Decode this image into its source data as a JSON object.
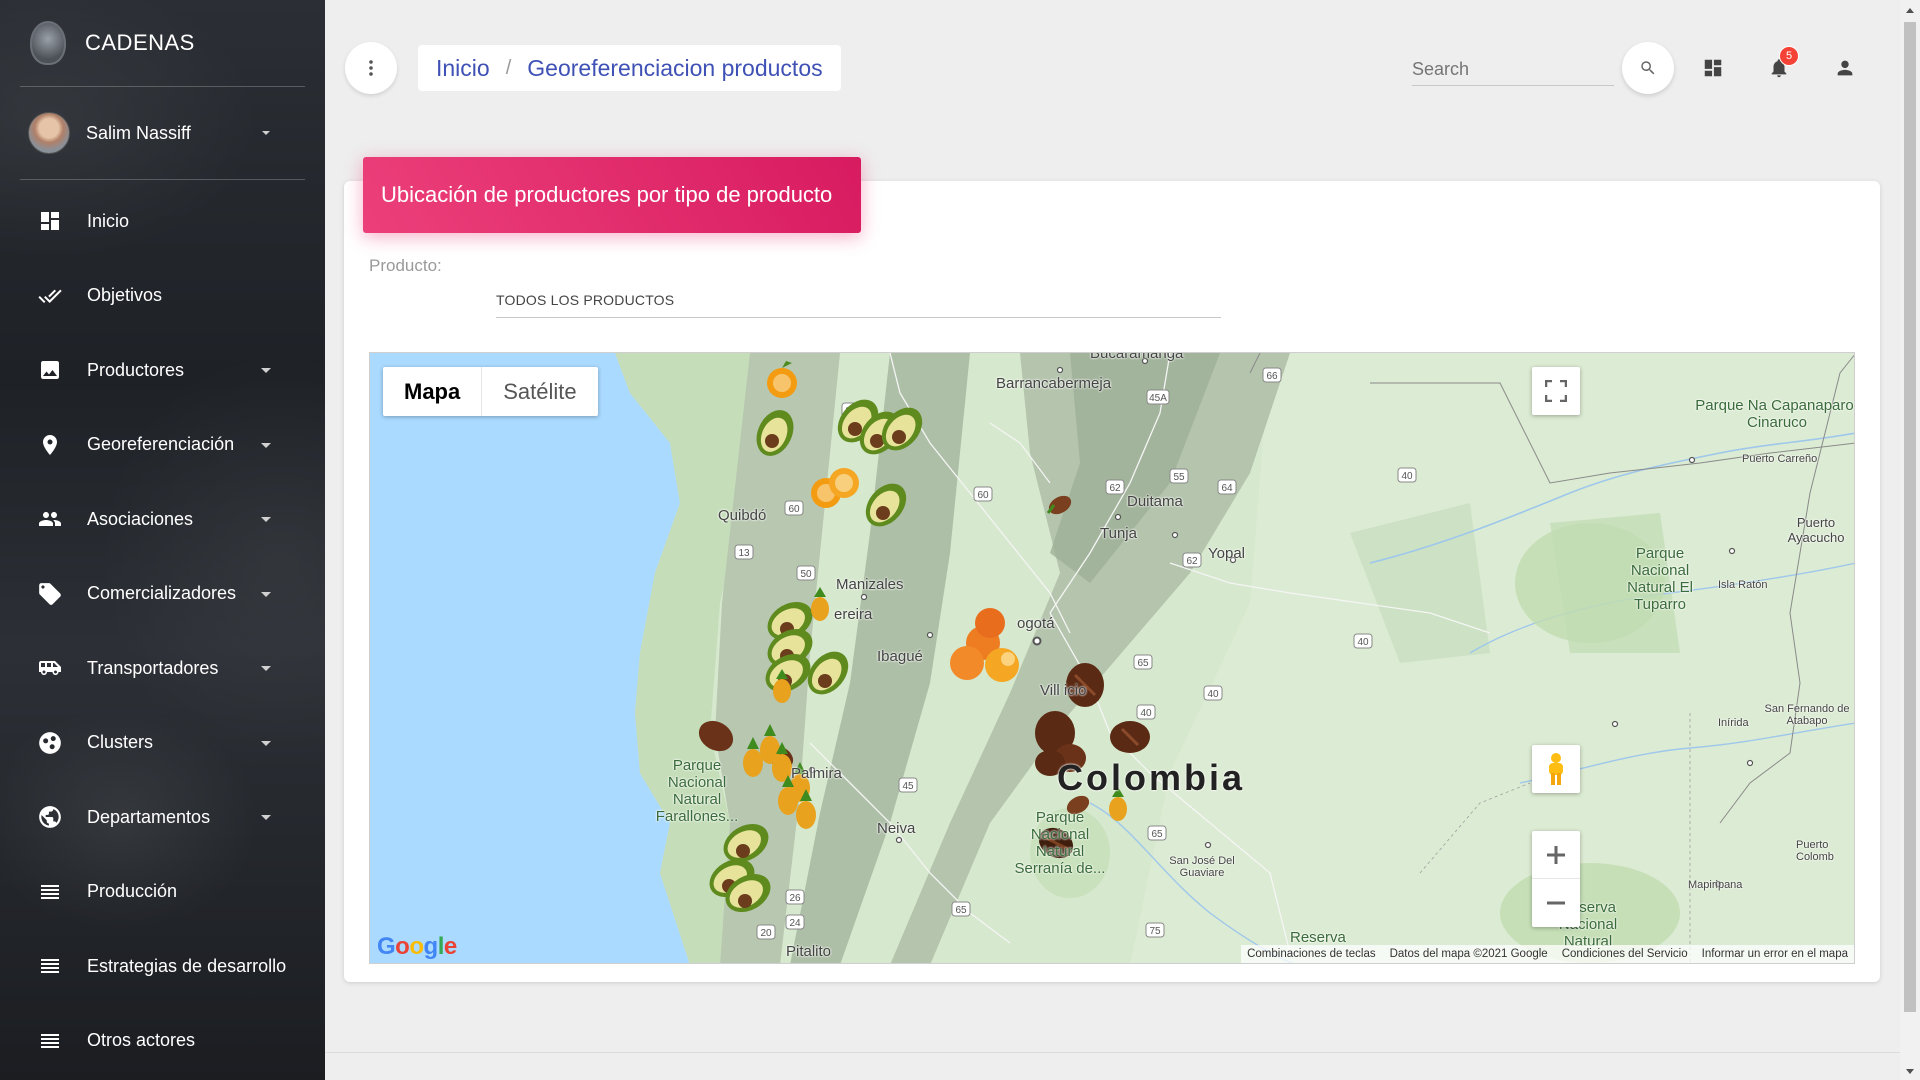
{
  "brand": {
    "name": "CADENAS"
  },
  "user": {
    "name": "Salim Nassiff"
  },
  "nav": {
    "items": [
      {
        "label": "Inicio",
        "icon": "dashboard-icon"
      },
      {
        "label": "Objetivos",
        "icon": "double-check-icon"
      },
      {
        "label": "Productores",
        "icon": "image-icon"
      },
      {
        "label": "Georeferenciación",
        "icon": "location-pin-icon"
      },
      {
        "label": "Asociaciones",
        "icon": "people-icon"
      },
      {
        "label": "Comercializadores",
        "icon": "tag-icon"
      },
      {
        "label": "Transportadores",
        "icon": "bus-icon"
      },
      {
        "label": "Clusters",
        "icon": "bubbles-icon"
      },
      {
        "label": "Departamentos",
        "icon": "globe-icon"
      },
      {
        "label": "Producción",
        "icon": "list-icon"
      },
      {
        "label": "Estrategias de desarrollo",
        "icon": "list-icon"
      },
      {
        "label": "Otros actores",
        "icon": "list-icon"
      }
    ]
  },
  "breadcrumb": {
    "home": "Inicio",
    "separator": "/",
    "current": "Georeferenciacion productos"
  },
  "search": {
    "placeholder": "Search"
  },
  "notifications": {
    "count": "5"
  },
  "card": {
    "title": "Ubicación de productores por tipo de producto",
    "product_label": "Producto:",
    "product_value": "TODOS LOS PRODUCTOS"
  },
  "map": {
    "type_options": {
      "map": "Mapa",
      "satellite": "Satélite"
    },
    "labels": {
      "bucaramanga": "Bucaramanga",
      "barrancabermeja": "Barrancabermeja",
      "quibdo": "Quibdó",
      "manizales": "Manizales",
      "pereira": "ereira",
      "ibague": "Ibagué",
      "bogota": "ogotá",
      "tunja": "Tunja",
      "duitama": "Duitama",
      "yopal": "Yopal",
      "villavicencio": "Vill   icio",
      "colombia": "Colombia",
      "palmira": "Palmira",
      "neiva": "Neiva",
      "pitalito": "Pitalito",
      "sanjose": "San José Del Guaviare",
      "mapiripana": "Mapiripana",
      "inirida": "Inírida",
      "islaraton": "Isla Ratón",
      "puertocarreno": "Puerto Carreño",
      "puertoayacucho": "Puerto Ayacucho",
      "sanfernando": "San Fernando de Atabapo",
      "farallones": "Parque Nacional Natural Farallones...",
      "macarena": "Parque Nacional Natural Serranía de...",
      "tuparro": "Parque Nacional Natural El Tuparro",
      "capanaparo": "Parque Na Capanaparo-Cinaruco",
      "nukak": "Reserva Nacional Natural",
      "reserva": "Reserva",
      "puertocolombia": "Puerto Colomb"
    },
    "attribution": {
      "shortcuts": "Combinaciones de teclas",
      "data": "Datos del mapa ©2021 Google",
      "terms": "Condiciones del Servicio",
      "report": "Informar un error en el mapa"
    },
    "google": "Google"
  }
}
